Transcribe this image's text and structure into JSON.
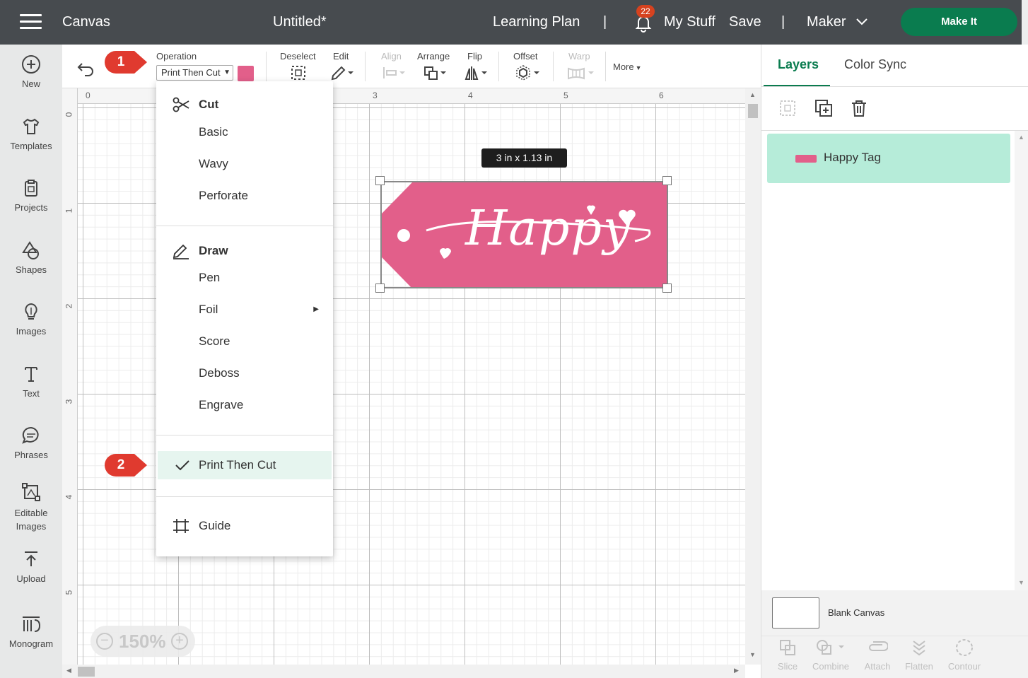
{
  "topbar": {
    "app_title": "Canvas",
    "doc_title": "Untitled*",
    "learning_plan": "Learning Plan",
    "divider": "|",
    "notification_count": "22",
    "my_stuff": "My Stuff",
    "save": "Save",
    "machine": "Maker",
    "make_it": "Make It"
  },
  "sidebar": {
    "items": [
      {
        "label": "New",
        "icon": "plus-circle-icon"
      },
      {
        "label": "Templates",
        "icon": "shirt-icon"
      },
      {
        "label": "Projects",
        "icon": "clipboard-icon"
      },
      {
        "label": "Shapes",
        "icon": "shapes-icon"
      },
      {
        "label": "Images",
        "icon": "lightbulb-icon"
      },
      {
        "label": "Text",
        "icon": "text-icon"
      },
      {
        "label": "Phrases",
        "icon": "speech-bubble-icon"
      },
      {
        "label": "Editable Images",
        "icon": "editable-image-icon"
      },
      {
        "label": "Upload",
        "icon": "upload-icon"
      },
      {
        "label": "Monogram",
        "icon": "monogram-icon"
      }
    ]
  },
  "toolbar": {
    "operation_label": "Operation",
    "operation_value": "Print Then Cut",
    "operation_color": "#e25f8a",
    "deselect": "Deselect",
    "edit": "Edit",
    "align": "Align",
    "arrange": "Arrange",
    "flip": "Flip",
    "offset": "Offset",
    "warp": "Warp",
    "more": "More"
  },
  "ruler": {
    "top": [
      "0",
      "3",
      "4",
      "5",
      "6"
    ],
    "left": [
      "0",
      "1",
      "2",
      "3",
      "4",
      "5"
    ]
  },
  "canvas": {
    "size_tooltip": "3  in x 1.13  in",
    "tag_text": "Happy",
    "tag_color": "#e25f8a",
    "zoom": "150%"
  },
  "dropdown": {
    "cut_header": "Cut",
    "cut_items": [
      "Basic",
      "Wavy",
      "Perforate"
    ],
    "draw_header": "Draw",
    "draw_items": [
      "Pen",
      "Foil",
      "Score",
      "Deboss",
      "Engrave"
    ],
    "selected": "Print Then Cut",
    "guide": "Guide"
  },
  "callouts": [
    "1",
    "2"
  ],
  "right_panel": {
    "tabs": [
      "Layers",
      "Color Sync"
    ],
    "layer_name": "Happy Tag",
    "blank_canvas": "Blank Canvas",
    "bottom_tools": [
      "Slice",
      "Combine",
      "Attach",
      "Flatten",
      "Contour"
    ]
  },
  "colors": {
    "accent": "#0a7c4f",
    "topbar": "#474b4f",
    "callout": "#e03a2f",
    "layer_bg": "#b6ecd9"
  }
}
